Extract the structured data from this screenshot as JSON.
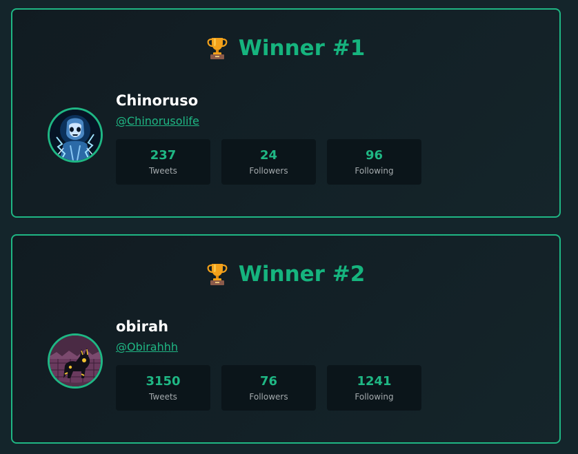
{
  "accent_color": "#1fb784",
  "background_color": "#14252b",
  "winners": [
    {
      "title": "Winner #1",
      "trophy_icon": "trophy-icon",
      "name": "Chinoruso",
      "handle": "@Chinorusolife",
      "stats": [
        {
          "value": "237",
          "label": "Tweets"
        },
        {
          "value": "24",
          "label": "Followers"
        },
        {
          "value": "96",
          "label": "Following"
        }
      ]
    },
    {
      "title": "Winner #2",
      "trophy_icon": "trophy-icon",
      "name": "obirah",
      "handle": "@Obirahhh",
      "stats": [
        {
          "value": "3150",
          "label": "Tweets"
        },
        {
          "value": "76",
          "label": "Followers"
        },
        {
          "value": "1241",
          "label": "Following"
        }
      ]
    }
  ]
}
